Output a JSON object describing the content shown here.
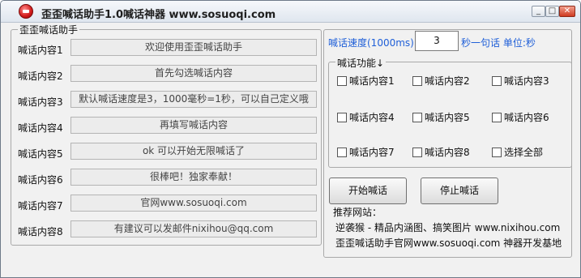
{
  "window": {
    "title": "歪歪喊话助手1.0喊话神器 www.sosuoqi.com",
    "min_label": "_",
    "max_label": "□",
    "close_label": "✕"
  },
  "messages": {
    "group_title": "歪歪喊话助手",
    "rows": [
      {
        "label": "喊话内容1",
        "value": "欢迎使用歪歪喊话助手"
      },
      {
        "label": "喊话内容2",
        "value": "首先勾选喊话内容"
      },
      {
        "label": "喊话内容3",
        "value": "默认喊话速度是3，1000毫秒=1秒，可以自己定义哦"
      },
      {
        "label": "喊话内容4",
        "value": "再填写喊话内容"
      },
      {
        "label": "喊话内容5",
        "value": "ok  可以开始无限喊话了"
      },
      {
        "label": "喊话内容6",
        "value": "很棒吧！独家奉献！"
      },
      {
        "label": "喊话内容7",
        "value": "官网www.sosuoqi.com"
      },
      {
        "label": "喊话内容8",
        "value": "有建议可以发邮件nixihou@qq.com"
      }
    ]
  },
  "speed": {
    "label": "喊话速度(1000ms):",
    "value": "3",
    "unit_text": "秒一句话 单位:秒"
  },
  "functions": {
    "title": "喊话功能↓",
    "checkboxes": [
      {
        "label": "喊话内容1",
        "checked": false
      },
      {
        "label": "喊话内容2",
        "checked": false
      },
      {
        "label": "喊话内容3",
        "checked": false
      },
      {
        "label": "喊话内容4",
        "checked": false
      },
      {
        "label": "喊话内容5",
        "checked": false
      },
      {
        "label": "喊话内容6",
        "checked": false
      },
      {
        "label": "喊话内容7",
        "checked": false
      },
      {
        "label": "喊话内容8",
        "checked": false
      },
      {
        "label": "选择全部",
        "checked": false
      }
    ]
  },
  "buttons": {
    "start": "开始喊话",
    "stop": "停止喊话"
  },
  "recommend": {
    "title": "推荐网站：",
    "line1": "逆袭猴 - 精品内涵图、搞笑图片 www.nixihou.com",
    "line2": "歪歪喊话助手官网www.sosuoqi.com 神器开发基地"
  },
  "colors": {
    "accent_blue": "#1f5fd8",
    "close_red": "#cf3a20"
  }
}
